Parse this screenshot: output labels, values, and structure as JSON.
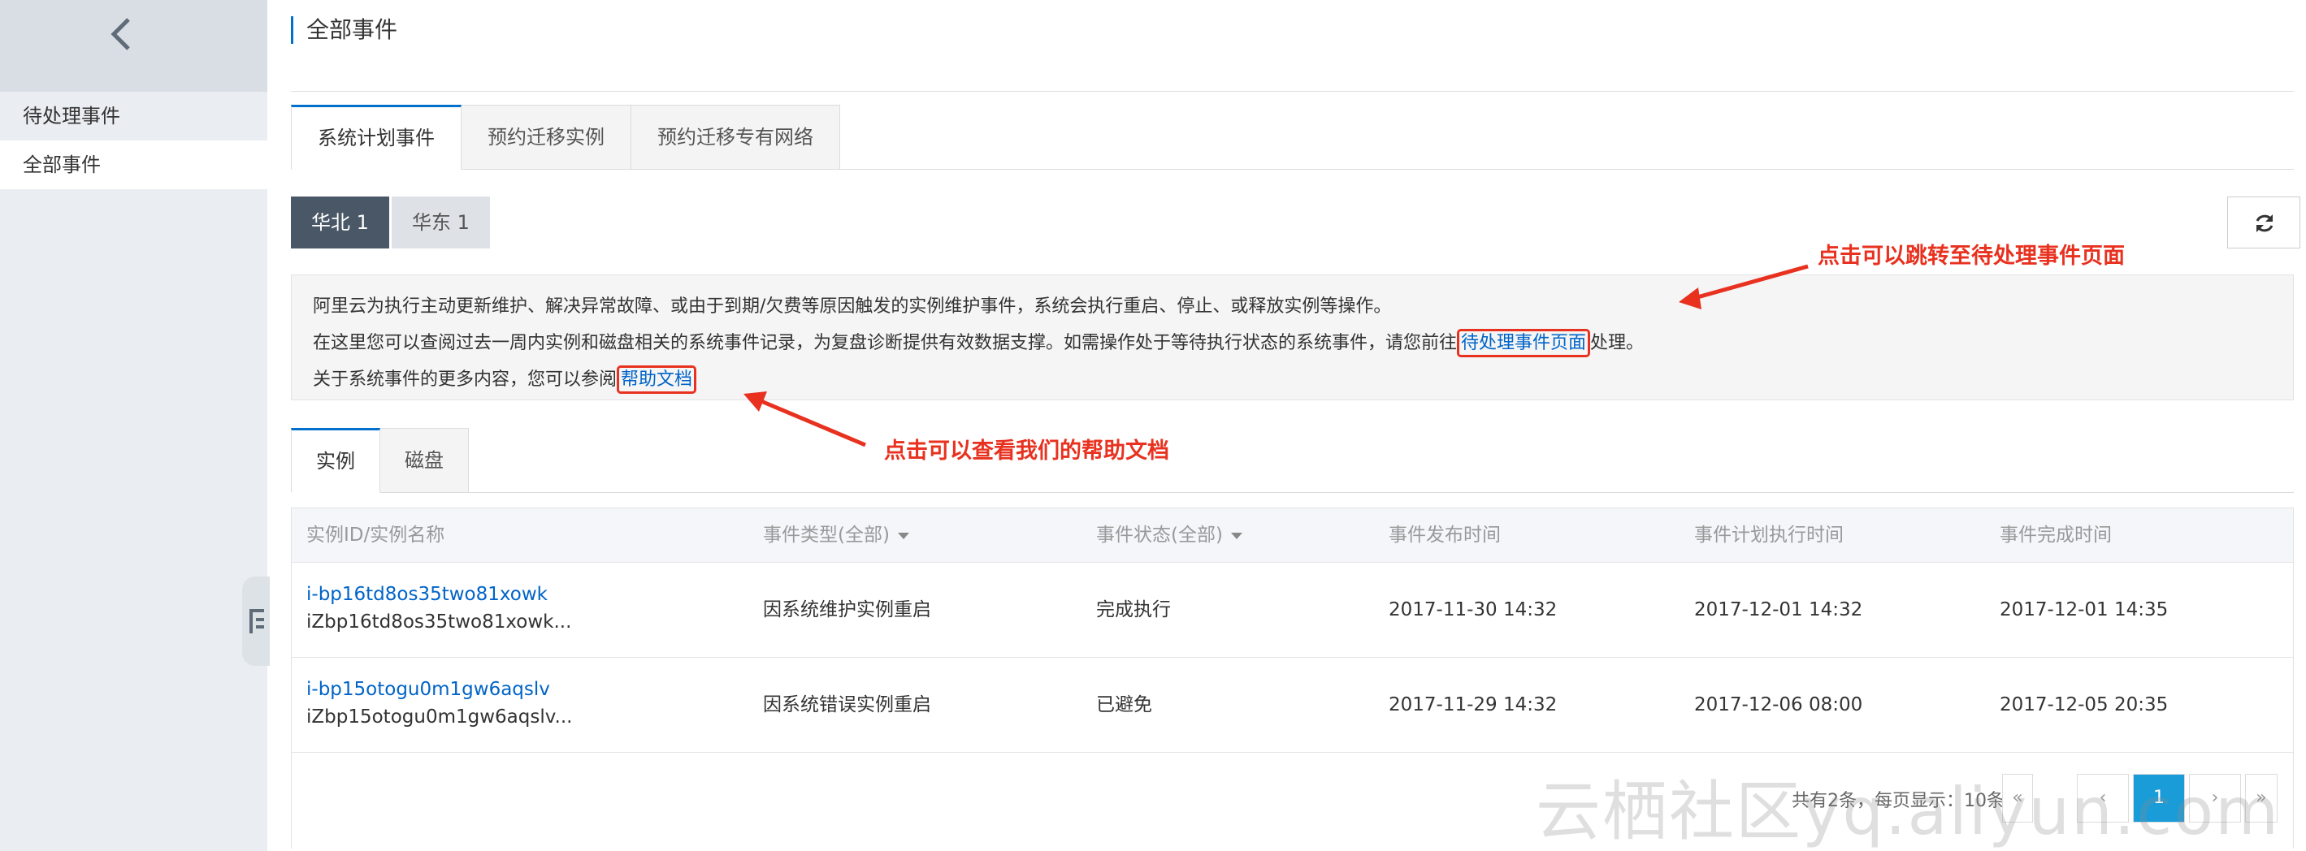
{
  "sidebar": {
    "items": [
      {
        "label": "待处理事件"
      },
      {
        "label": "全部事件"
      }
    ]
  },
  "header": {
    "title": "全部事件"
  },
  "main_tabs": [
    {
      "label": "系统计划事件"
    },
    {
      "label": "预约迁移实例"
    },
    {
      "label": "预约迁移专有网络"
    }
  ],
  "regions": [
    {
      "label": "华北 1"
    },
    {
      "label": "华东 1"
    }
  ],
  "notice": {
    "line1": "阿里云为执行主动更新维护、解决异常故障、或由于到期/欠费等原因触发的实例维护事件，系统会执行重启、停止、或释放实例等操作。",
    "line2_before": "在这里您可以查阅过去一周内实例和磁盘相关的系统事件记录，为复盘诊断提供有效数据支撑。如需操作处于等待执行状态的系统事件，请您前往",
    "line2_link": "待处理事件页面",
    "line2_after": "处理。",
    "line3_before": "关于系统事件的更多内容，您可以参阅",
    "line3_link": "帮助文档"
  },
  "annotations": {
    "top": "点击可以跳转至待处理事件页面",
    "bottom": "点击可以查看我们的帮助文档"
  },
  "sub_tabs": [
    {
      "label": "实例"
    },
    {
      "label": "磁盘"
    }
  ],
  "table": {
    "headers": [
      "实例ID/实例名称",
      "事件类型(全部)",
      "事件状态(全部)",
      "事件发布时间",
      "事件计划执行时间",
      "事件完成时间"
    ],
    "rows": [
      {
        "id": "i-bp16td8os35two81xowk",
        "name": "iZbp16td8os35two81xowk...",
        "type": "因系统维护实例重启",
        "status": "完成执行",
        "published": "2017-11-30 14:32",
        "planned": "2017-12-01 14:32",
        "completed": "2017-12-01 14:35"
      },
      {
        "id": "i-bp15otogu0m1gw6aqslv",
        "name": "iZbp15otogu0m1gw6aqslv...",
        "type": "因系统错误实例重启",
        "status": "已避免",
        "published": "2017-11-29 14:32",
        "planned": "2017-12-06 08:00",
        "completed": "2017-12-05 20:35"
      }
    ]
  },
  "pagination": {
    "info": "共有2条，每页显示：10条",
    "first": "«",
    "prev": "‹",
    "current": "1",
    "next": "›",
    "last": "»"
  },
  "watermark": "云栖社区yq.aliyun.com",
  "colors": {
    "accent": "#0070cc",
    "link": "#0064c8",
    "annotation": "#e8311f",
    "region_active": "#4a5767",
    "page_active": "#1a9cd9"
  },
  "icons": [
    "chevron-left-icon",
    "refresh-icon",
    "side-toggle-icon"
  ]
}
